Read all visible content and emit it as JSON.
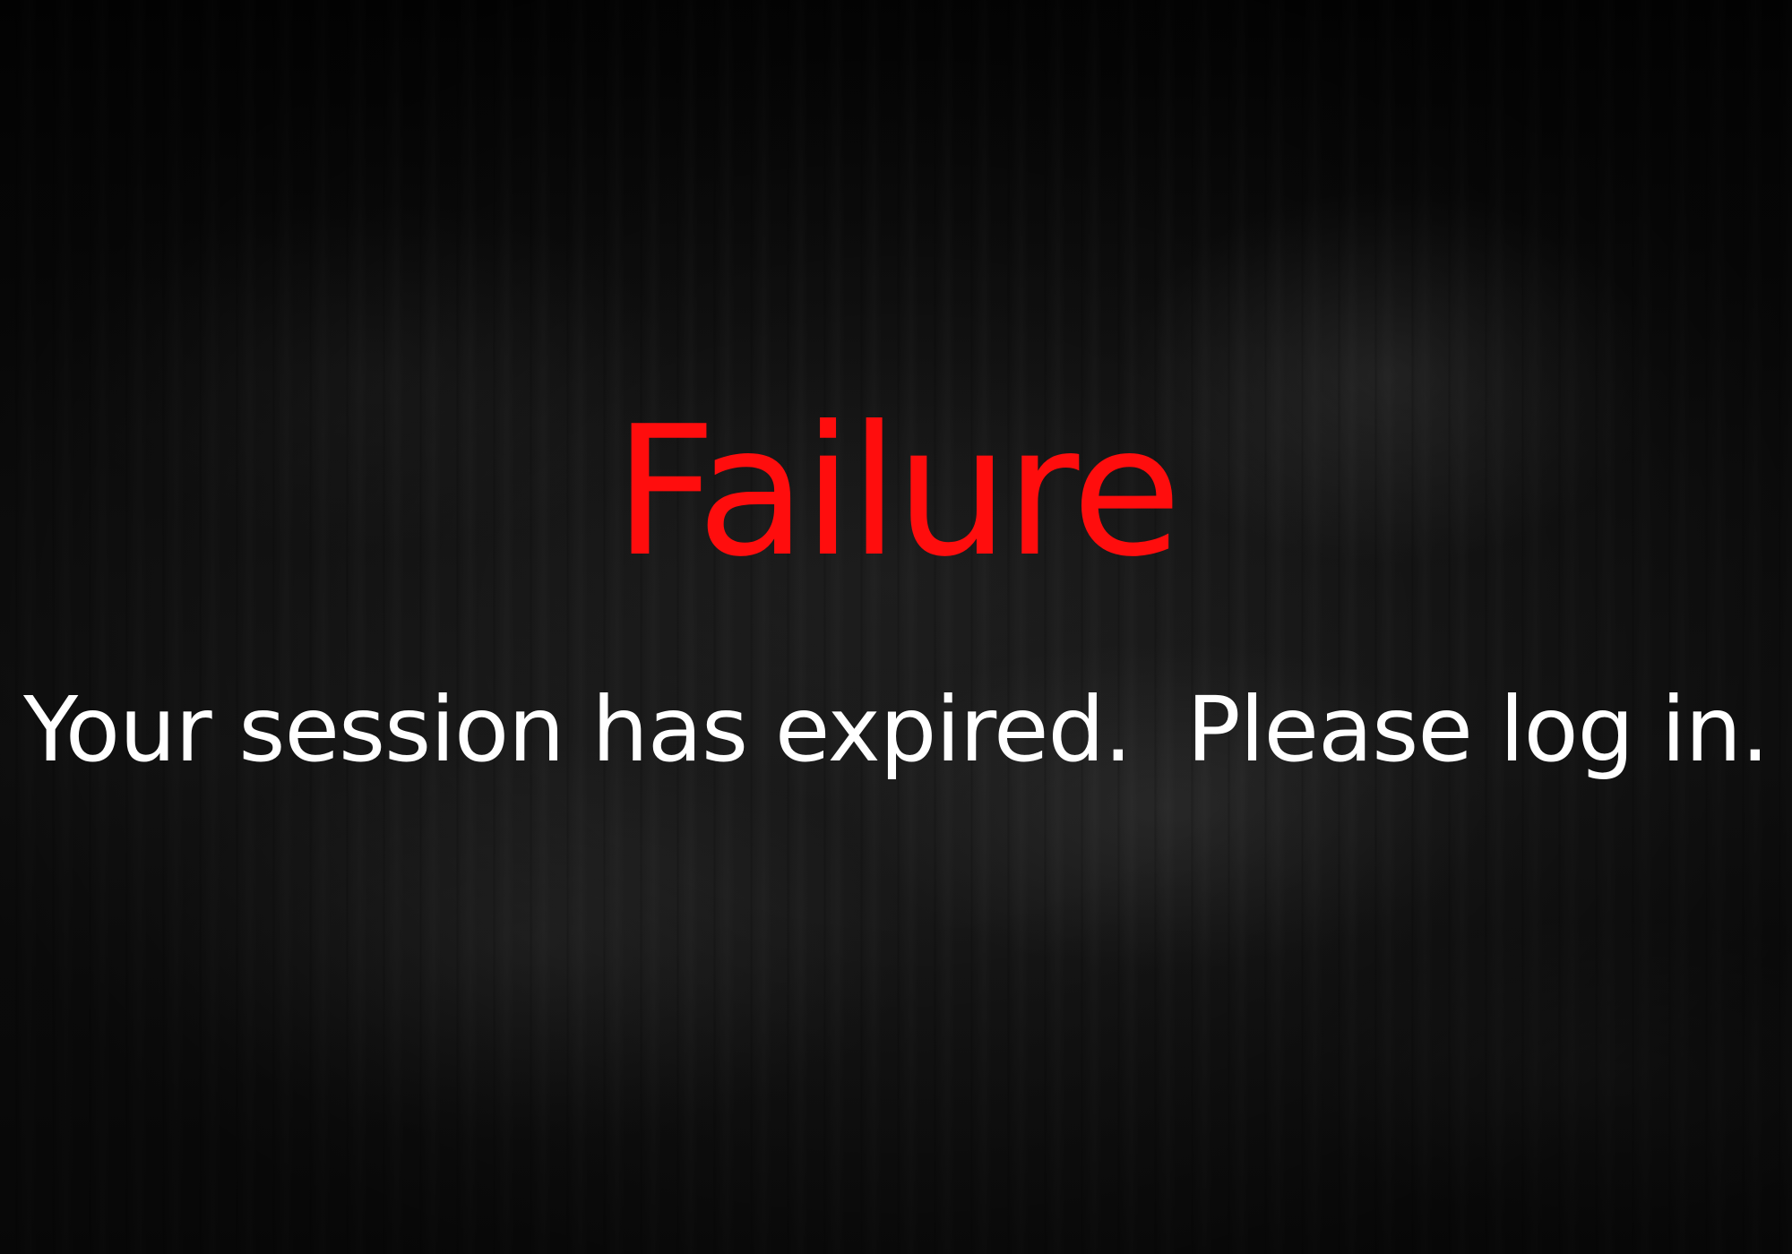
{
  "colors": {
    "title": "#ff0d0d",
    "message": "#ffffff",
    "background": "#0d0d0d"
  },
  "error": {
    "title": "Failure",
    "message": "Your session has expired.  Please log in."
  }
}
